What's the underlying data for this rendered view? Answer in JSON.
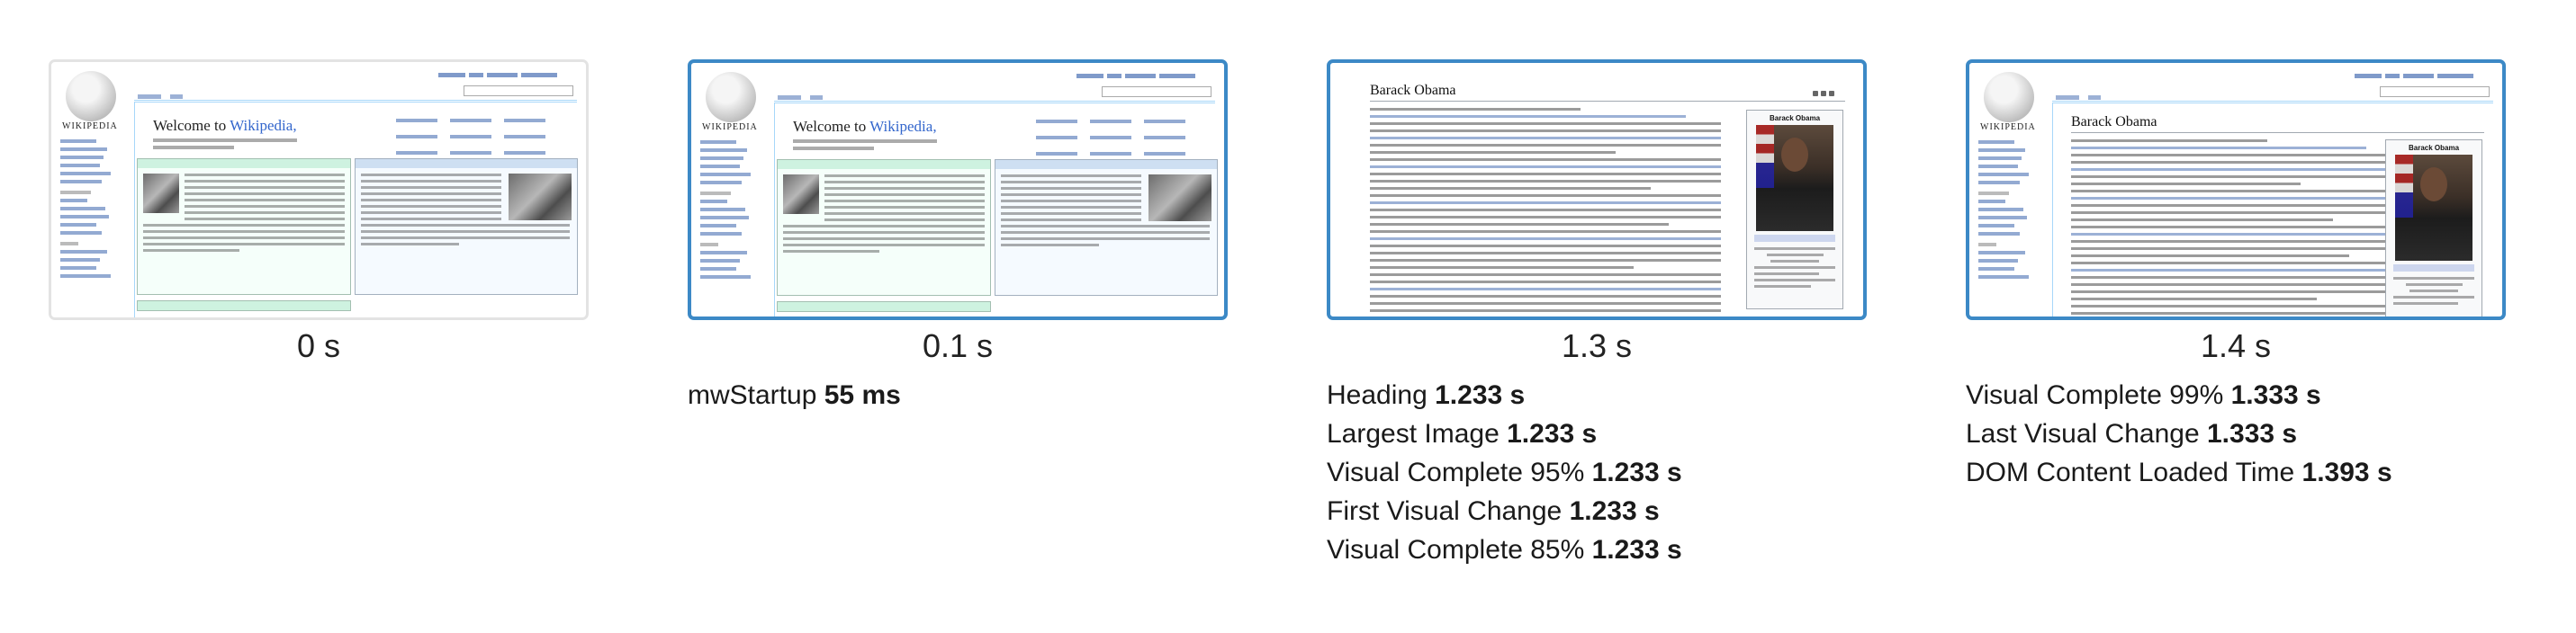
{
  "frames": [
    {
      "time": "0 s",
      "page": "main-page",
      "highlighted": false,
      "thumb": {
        "logo_text": "WIKIPEDIA",
        "welcome_prefix": "Welcome to ",
        "welcome_link": "Wikipedia,"
      },
      "metrics": []
    },
    {
      "time": "0.1 s",
      "page": "main-page",
      "highlighted": true,
      "thumb": {
        "logo_text": "WIKIPEDIA",
        "welcome_prefix": "Welcome to ",
        "welcome_link": "Wikipedia,"
      },
      "metrics": [
        {
          "label": "mwStartup",
          "value": "55 ms"
        }
      ]
    },
    {
      "time": "1.3 s",
      "page": "article",
      "highlighted": true,
      "thumb": {
        "title": "Barack Obama",
        "infobox_name": "Barack Obama"
      },
      "metrics": [
        {
          "label": "Heading",
          "value": "1.233 s"
        },
        {
          "label": "Largest Image",
          "value": "1.233 s"
        },
        {
          "label": "Visual Complete 95%",
          "value": "1.233 s"
        },
        {
          "label": "First Visual Change",
          "value": "1.233 s"
        },
        {
          "label": "Visual Complete 85%",
          "value": "1.233 s"
        }
      ]
    },
    {
      "time": "1.4 s",
      "page": "article-with-logo",
      "highlighted": true,
      "thumb": {
        "title": "Barack Obama",
        "infobox_name": "Barack Obama",
        "logo_text": "WIKIPEDIA"
      },
      "metrics": [
        {
          "label": "Visual Complete 99%",
          "value": "1.333 s"
        },
        {
          "label": "Last Visual Change",
          "value": "1.333 s"
        },
        {
          "label": "DOM Content Loaded Time",
          "value": "1.393 s"
        }
      ]
    }
  ],
  "colors": {
    "highlight_border": "#3c89c6",
    "plain_border": "#e3e3e3",
    "link": "#3366cc"
  }
}
